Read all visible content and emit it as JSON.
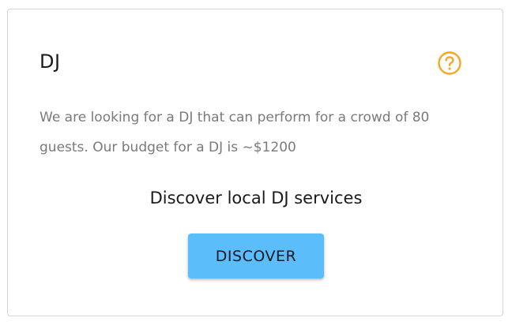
{
  "card": {
    "title": "DJ",
    "help_icon": "question-circle-icon",
    "description": "We are looking for a DJ that can perform for a crowd of 80 guests. Our budget for a DJ is ~$1200",
    "cta_text": "Discover local DJ services",
    "button_label": "DISCOVER"
  },
  "colors": {
    "accent_help": "#f5a623",
    "button_bg": "#5bbdfa"
  }
}
